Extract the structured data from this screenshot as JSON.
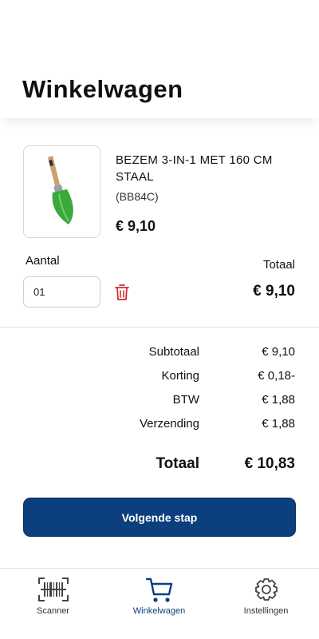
{
  "header": {
    "title": "Winkelwagen"
  },
  "product": {
    "title": "BEZEM 3-IN-1 MET 160 CM STAAL",
    "sku": "(BB84C)",
    "price": "€ 9,10",
    "image_icon": "garden-trowel-icon"
  },
  "quantity": {
    "label": "Aantal",
    "value": "01"
  },
  "line_total": {
    "label": "Totaal",
    "value": "€ 9,10"
  },
  "summary": {
    "rows": [
      {
        "label": "Subtotaal",
        "value": "€ 9,10"
      },
      {
        "label": "Korting",
        "value": "€ 0,18-"
      },
      {
        "label": "BTW",
        "value": "€ 1,88"
      },
      {
        "label": "Verzending",
        "value": "€ 1,88"
      }
    ],
    "total_label": "Totaal",
    "total_value": "€ 10,83"
  },
  "next_button": {
    "label": "Volgende stap"
  },
  "tabbar": {
    "tabs": [
      {
        "label": "Scanner",
        "icon": "barcode-scanner-icon"
      },
      {
        "label": "Winkelwagen",
        "icon": "cart-icon",
        "active": true
      },
      {
        "label": "Instellingen",
        "icon": "gear-icon"
      }
    ]
  },
  "colors": {
    "primary": "#0b3f7d",
    "danger": "#d32f2f",
    "product_green": "#3aa83a"
  }
}
